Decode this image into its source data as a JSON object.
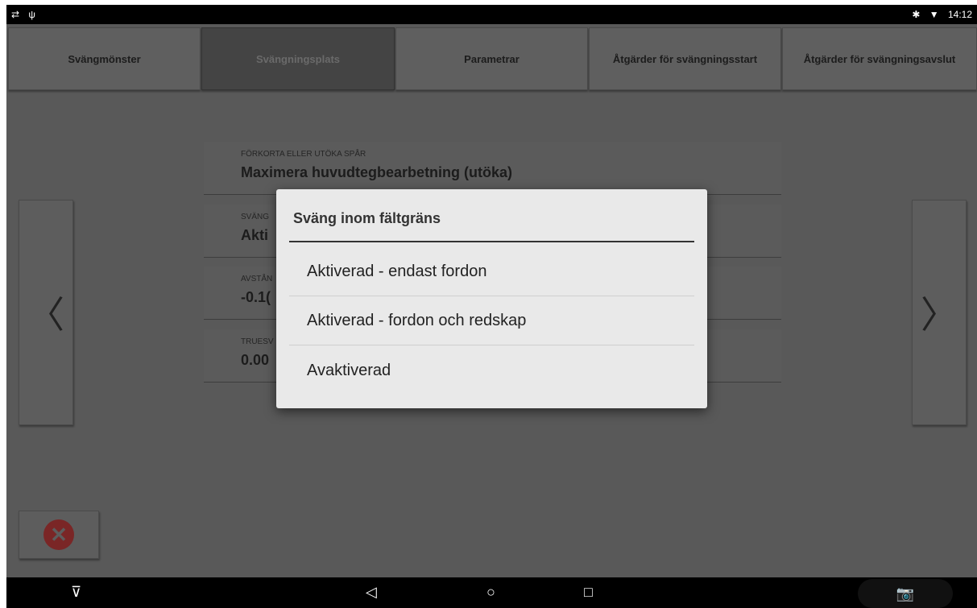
{
  "status_bar": {
    "left_icons": "⇄ ψ",
    "bluetooth_icon": "✱",
    "wifi_icon": "▼",
    "time": "14:12"
  },
  "tabs": [
    {
      "label": "Svängmönster"
    },
    {
      "label": "Svängningsplats",
      "selected": true
    },
    {
      "label": "Parametrar"
    },
    {
      "label": "Åtgärder för svängningsstart"
    },
    {
      "label": "Åtgärder för svängningsavslut"
    }
  ],
  "fields": [
    {
      "label": "FÖRKORTA ELLER UTÖKA SPÅR",
      "value": "Maximera huvudtegbearbetning (utöka)"
    },
    {
      "label": "SVÄNG",
      "value": "Akti"
    },
    {
      "label": "AVSTÅN",
      "value": "-0.1("
    },
    {
      "label": "TRUESV",
      "value": "0.00"
    }
  ],
  "nav": {
    "prev": "〈",
    "next": "〉"
  },
  "cancel": {
    "glyph": "✕",
    "color": "#7a2626"
  },
  "dialog": {
    "title": "Sväng inom fältgräns",
    "options": [
      {
        "label": "Aktiverad - endast fordon"
      },
      {
        "label": "Aktiverad - fordon och redskap"
      },
      {
        "label": "Avaktiverad"
      }
    ]
  },
  "navbar": {
    "brand_icon": "⊽",
    "back": "◁",
    "home": "○",
    "recents": "□",
    "camera": "📷"
  }
}
